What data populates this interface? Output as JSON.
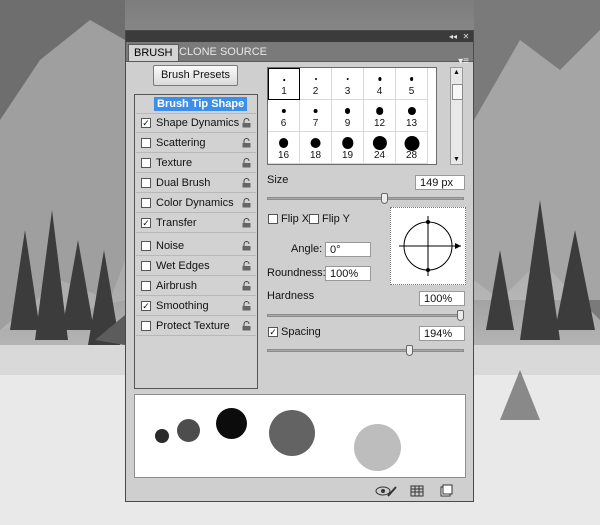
{
  "panel": {
    "tabs": [
      {
        "label": "BRUSH",
        "active": true
      },
      {
        "label": "CLONE SOURCE",
        "active": false
      }
    ],
    "collapse_glyph": "◂◂",
    "close_glyph": "✕",
    "menu_glyph": "▾≡",
    "brush_presets_label": "Brush Presets"
  },
  "settings_list": {
    "header": "Brush Tip Shape",
    "items": [
      {
        "label": "Shape Dynamics",
        "checked": true
      },
      {
        "label": "Scattering",
        "checked": false
      },
      {
        "label": "Texture",
        "checked": false
      },
      {
        "label": "Dual Brush",
        "checked": false
      },
      {
        "label": "Color Dynamics",
        "checked": false
      },
      {
        "label": "Transfer",
        "checked": true
      },
      {
        "label": "Noise",
        "checked": false
      },
      {
        "label": "Wet Edges",
        "checked": false
      },
      {
        "label": "Airbrush",
        "checked": false
      },
      {
        "label": "Smoothing",
        "checked": true
      },
      {
        "label": "Protect Texture",
        "checked": false
      }
    ]
  },
  "brush_tips": [
    {
      "size": "1"
    },
    {
      "size": "2"
    },
    {
      "size": "3"
    },
    {
      "size": "4"
    },
    {
      "size": "5"
    },
    {
      "size": "6"
    },
    {
      "size": "7"
    },
    {
      "size": "9"
    },
    {
      "size": "12"
    },
    {
      "size": "13"
    },
    {
      "size": "16"
    },
    {
      "size": "18"
    },
    {
      "size": "19"
    },
    {
      "size": "24"
    },
    {
      "size": "28"
    }
  ],
  "controls": {
    "size_label": "Size",
    "size_value": "149 px",
    "flip_x_label": "Flip X",
    "flip_y_label": "Flip Y",
    "angle_label": "Angle:",
    "angle_value": "0°",
    "roundness_label": "Roundness:",
    "roundness_value": "100%",
    "hardness_label": "Hardness",
    "hardness_value": "100%",
    "spacing_label": "Spacing",
    "spacing_value": "194%",
    "spacing_checked": true
  },
  "sliders": {
    "size_fraction": 0.6,
    "hardness_fraction": 1.0,
    "spacing_fraction": 0.73
  },
  "colors": {
    "selection": "#3d8ee8",
    "panel": "#cfcfcf",
    "titlebar": "#3b3b3b"
  },
  "icons": [
    "collapse-icon",
    "close-icon",
    "panel-menu-icon",
    "lock-icon",
    "eye-brush-icon",
    "grid-panel-icon",
    "new-preset-icon"
  ]
}
